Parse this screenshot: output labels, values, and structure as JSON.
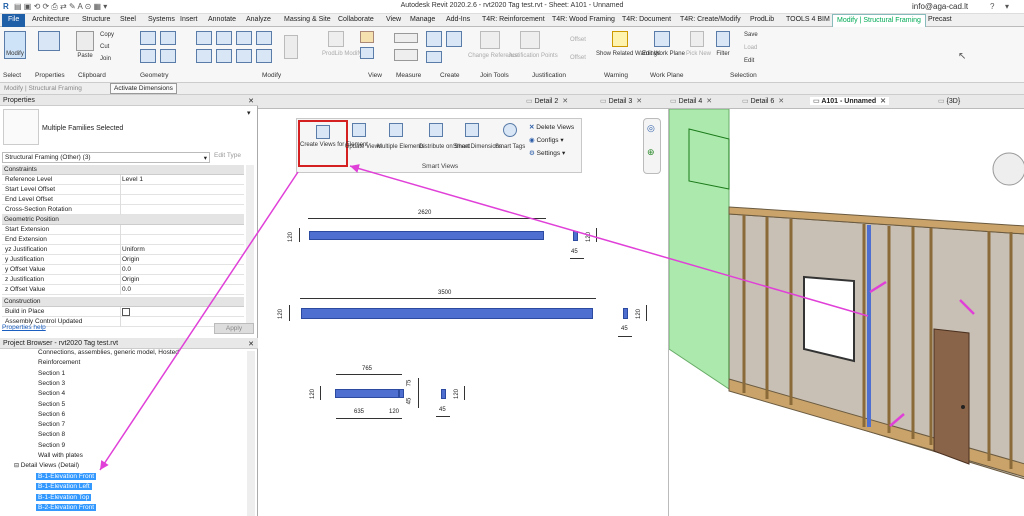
{
  "app": {
    "title": "Autodesk Revit 2020.2.6 - rvt2020 Tag test.rvt - Sheet: A101 - Unnamed",
    "user": "info@aga-cad.lt"
  },
  "ribbon_tabs": [
    "File",
    "Architecture",
    "Structure",
    "Steel",
    "Systems",
    "Insert",
    "Annotate",
    "Analyze",
    "Massing & Site",
    "Collaborate",
    "View",
    "Manage",
    "Add-Ins",
    "T4R: Reinforcement",
    "T4R: Wood Framing",
    "T4R: Document",
    "T4R: Create/Modify",
    "ProdLib",
    "TOOLS 4 BIM",
    "Modify | Structural Framing",
    "Precast"
  ],
  "ribbon": {
    "modify": "Modify",
    "copy": "Copy",
    "cut": "Cut",
    "join": "Join",
    "paste": "Paste",
    "change_reference": "Change Reference",
    "justification_points": "Justification Points",
    "offset1": "Offset",
    "offset2": "Offset",
    "show_related_warnings": "Show Related Warnings",
    "edit_work_plane": "Edit Work Plane",
    "pick_new": "Pick New",
    "filter": "Filter",
    "save": "Save",
    "load": "Load",
    "edit": "Edit",
    "prodlib_modify": "ProdLib Modify",
    "groups": [
      "Select",
      "Properties",
      "Clipboard",
      "Geometry",
      "Modify",
      "View",
      "Measure",
      "Create",
      "Join Tools",
      "Justification",
      "Warning",
      "Work Plane",
      "Selection"
    ]
  },
  "optionsbar": {
    "context": "Modify | Structural Framing",
    "activate_dimensions": "Activate Dimensions"
  },
  "properties": {
    "title": "Properties",
    "type_name": "Multiple Families Selected",
    "selector": "Structural Framing (Other) (3)",
    "edit_type": "Edit Type",
    "help": "Properties help",
    "apply": "Apply",
    "cat_constraints": "Constraints",
    "cat_geometric": "Geometric Position",
    "cat_construction": "Construction",
    "rows": [
      {
        "k": "Reference Level",
        "v": "Level 1"
      },
      {
        "k": "Start Level Offset",
        "v": ""
      },
      {
        "k": "End Level Offset",
        "v": ""
      },
      {
        "k": "Cross-Section Rotation",
        "v": ""
      },
      {
        "k": "Start Extension",
        "v": ""
      },
      {
        "k": "End Extension",
        "v": ""
      },
      {
        "k": "yz Justification",
        "v": "Uniform"
      },
      {
        "k": "y Justification",
        "v": "Origin"
      },
      {
        "k": "y Offset Value",
        "v": "0.0"
      },
      {
        "k": "z Justification",
        "v": "Origin"
      },
      {
        "k": "z Offset Value",
        "v": "0.0"
      },
      {
        "k": "Build in Place",
        "v": ""
      },
      {
        "k": "Assembly Control Updated",
        "v": ""
      }
    ]
  },
  "browser": {
    "title": "Project Browser - rvt2020 Tag test.rvt",
    "items": [
      "Connections, assemblies, generic model, Hosted",
      "Reinforcement",
      "Section 1",
      "Section 3",
      "Section 4",
      "Section 5",
      "Section 6",
      "Section 7",
      "Section 8",
      "Section 9",
      "Wall with plates"
    ],
    "detail_views": "Detail Views (Detail)",
    "selected": [
      "B-1-Elevation Front",
      "B-1-Elevation Left",
      "B-1-Elevation Top",
      "B-2-Elevation Front"
    ]
  },
  "doc_tabs": [
    "Detail 2",
    "Detail 3",
    "Detail 4",
    "Detail 6",
    "A101 - Unnamed",
    "{3D}"
  ],
  "smart_views": {
    "create_views": "Create Views for Element",
    "update_views": "Update Views",
    "multiple_elements": "Multiple Elements",
    "distribute": "Distribute on Sheet",
    "smart_dimensions": "Smart Dimensions",
    "smart_tags": "Smart Tags",
    "delete_views": "Delete Views",
    "configs": "Configs",
    "settings": "Settings",
    "panel_label": "Smart Views"
  },
  "drawing": {
    "d1_len": "2620",
    "d1_h": "120",
    "d1_w": "45",
    "d2_len": "3500",
    "d2_h": "120",
    "d2_w": "45",
    "d3_top": "765",
    "d3_h": "120",
    "d3_bot1": "635",
    "d3_bot2": "120",
    "d3_side": "75",
    "d3_side2": "45",
    "d3_w": "45",
    "d3_h2": "120"
  },
  "colors": {
    "accent": "#e040d8",
    "bar": "#4e6fd0",
    "highlight": "#d42020",
    "file_tab": "#1f5fa8"
  }
}
